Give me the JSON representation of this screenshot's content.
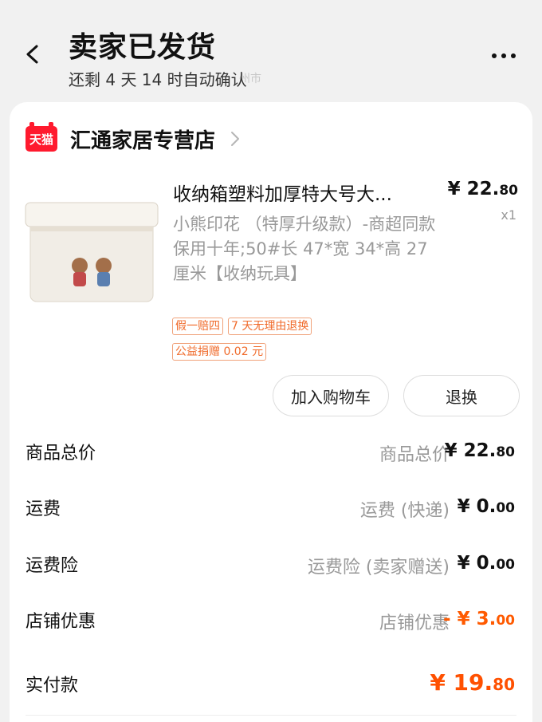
{
  "header": {
    "title": "卖家已发货",
    "subtitle": "还剩 4 天 14 时自动确认",
    "ghost_text": "州市"
  },
  "store": {
    "badge": "天猫",
    "name": "汇通家居专营店"
  },
  "product": {
    "title": "收纳箱塑料加厚特大号大...",
    "price_main": "¥ 22.",
    "price_cents": "80",
    "qty": "x1",
    "spec": "小熊印花 （特厚升级款）-商超同款 保用十年;50#长 47*宽 34*高 27 厘米【收纳玩具】",
    "tags": [
      "假一赔四",
      "7 天无理由退换",
      "公益捐赠 0.02 元"
    ]
  },
  "actions": {
    "add_to_cart": "加入购物车",
    "return": "退换"
  },
  "summary": {
    "items": [
      {
        "label": "商品总价",
        "desc": "商品总价",
        "main": "¥ 22.",
        "cents": "80"
      },
      {
        "label": "运费",
        "desc": "运费 (快递)",
        "main": "¥ 0.",
        "cents": "00"
      },
      {
        "label": "运费险",
        "desc": "运费险 (卖家赠送)",
        "main": "¥ 0.",
        "cents": "00"
      },
      {
        "label": "店铺优惠",
        "desc": "店铺优惠",
        "main": "- ¥ 3.",
        "cents": "00"
      }
    ],
    "total": {
      "label": "实付款",
      "main": "¥ 19.",
      "cents": "80"
    }
  },
  "colors": {
    "accent": "#ff5000",
    "tmall_red": "#ff1a2e",
    "tag_orange": "#f06a2a"
  }
}
